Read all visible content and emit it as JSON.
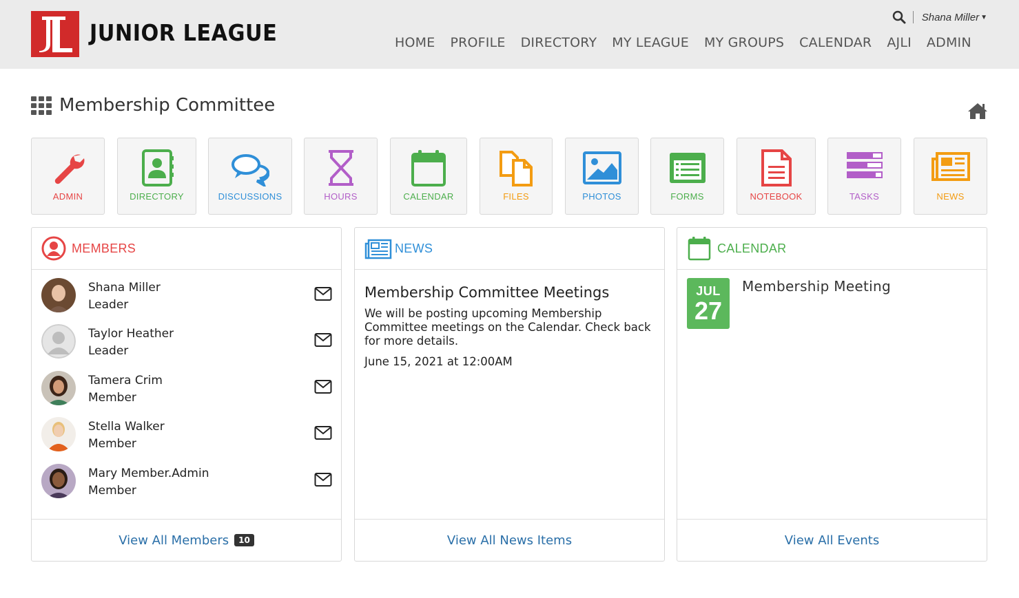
{
  "header": {
    "brand": "JUNIOR LEAGUE",
    "user_name": "Shana Miller",
    "nav": [
      "HOME",
      "PROFILE",
      "DIRECTORY",
      "MY LEAGUE",
      "MY GROUPS",
      "CALENDAR",
      "AJLI",
      "ADMIN"
    ]
  },
  "page": {
    "title": "Membership Committee"
  },
  "tools": [
    {
      "label": "ADMIN",
      "icon": "wrench-icon",
      "color": "#e64545"
    },
    {
      "label": "DIRECTORY",
      "icon": "contact-book-icon",
      "color": "#4cae4c"
    },
    {
      "label": "DISCUSSIONS",
      "icon": "chat-bubbles-icon",
      "color": "#2f8fd8"
    },
    {
      "label": "HOURS",
      "icon": "hourglass-icon",
      "color": "#b25ec8"
    },
    {
      "label": "CALENDAR",
      "icon": "calendar-icon",
      "color": "#4cae4c"
    },
    {
      "label": "FILES",
      "icon": "files-icon",
      "color": "#f39c12"
    },
    {
      "label": "PHOTOS",
      "icon": "photo-icon",
      "color": "#2f8fd8"
    },
    {
      "label": "FORMS",
      "icon": "form-icon",
      "color": "#4cae4c"
    },
    {
      "label": "NOTEBOOK",
      "icon": "notebook-icon",
      "color": "#e64545"
    },
    {
      "label": "TASKS",
      "icon": "tasks-icon",
      "color": "#b25ec8"
    },
    {
      "label": "NEWS",
      "icon": "newspaper-icon",
      "color": "#f39c12"
    }
  ],
  "members_panel": {
    "title": "MEMBERS",
    "members": [
      {
        "name": "Shana Miller",
        "role": "Leader"
      },
      {
        "name": "Taylor Heather",
        "role": "Leader"
      },
      {
        "name": "Tamera Crim",
        "role": "Member"
      },
      {
        "name": "Stella Walker",
        "role": "Member"
      },
      {
        "name": "Mary Member.Admin",
        "role": "Member"
      }
    ],
    "footer_link": "View All Members",
    "count": "10"
  },
  "news_panel": {
    "title": "NEWS",
    "item_title": "Membership Committee Meetings",
    "item_body": "We will be posting upcoming Membership Committee meetings on the Calendar. Check back for more details.",
    "item_date": "June 15, 2021 at 12:00AM",
    "footer_link": "View All News Items"
  },
  "calendar_panel": {
    "title": "CALENDAR",
    "event_month": "JUL",
    "event_day": "27",
    "event_title": "Membership Meeting",
    "footer_link": "View All Events"
  },
  "colors": {
    "brand_red": "#d12a2a",
    "members_accent": "#e64545",
    "news_accent": "#2f8fd8",
    "calendar_accent": "#4cae4c",
    "link": "#2a6fa8"
  }
}
